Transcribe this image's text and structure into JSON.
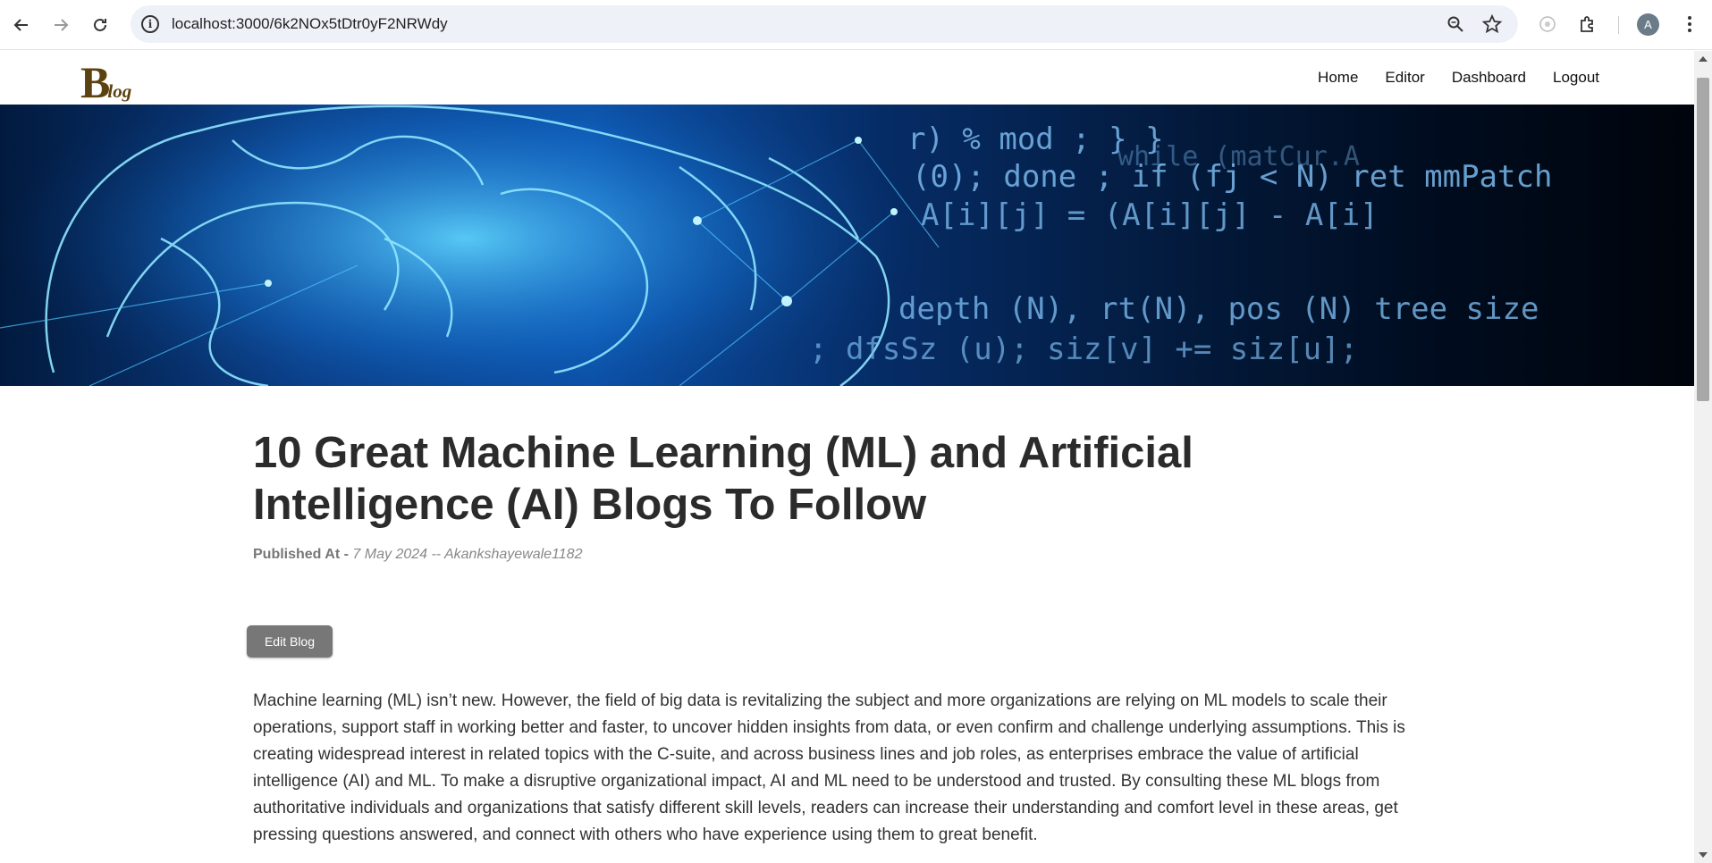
{
  "browser": {
    "url": "localhost:3000/6k2NOx5tDtr0yF2NRWdy",
    "avatar_letter": "A",
    "icons": [
      "back-icon",
      "forward-icon",
      "reload-icon",
      "site-info-icon",
      "zoom-icon",
      "bookmark-star-icon",
      "extension-icon",
      "puzzle-icon",
      "menu-kebab-icon"
    ]
  },
  "site": {
    "logo_big": "B",
    "logo_small": "log",
    "nav": [
      "Home",
      "Editor",
      "Dashboard",
      "Logout"
    ]
  },
  "hero": {
    "code_lines": [
      "r) % mod ; } }",
      "while (matCur.A",
      "(0); done ; if (fj < N) ret mmPatch",
      "A[i][j] = (A[i][j] - A[i]",
      "depth (N), rt(N), pos (N) tree size",
      "; dfsSz (u); siz[v] += siz[u];"
    ]
  },
  "article": {
    "title": "10 Great Machine Learning (ML) and Artificial Intelligence (AI) Blogs To Follow",
    "published_label": "Published At -",
    "published_value": "7 May 2024 -- Akankshayewale1182",
    "edit_button": "Edit Blog",
    "paragraph": "Machine learning (ML) isn’t new. However, the field of big data is revitalizing the subject and more organizations are relying on ML models to scale their operations, support staff in working better and faster, to uncover hidden insights from data, or even confirm and challenge underlying assumptions. This is creating widespread interest in related topics with the C-suite, and across business lines and job roles, as enterprises embrace the value of artificial intelligence (AI) and ML. To make a disruptive organizational impact, AI and ML need to be understood and trusted. By consulting these ML blogs from authoritative individuals and organizations that satisfy different skill levels, readers can increase their understanding and comfort level in these areas, get pressing questions answered, and connect with others who have experience using them to great benefit."
  }
}
